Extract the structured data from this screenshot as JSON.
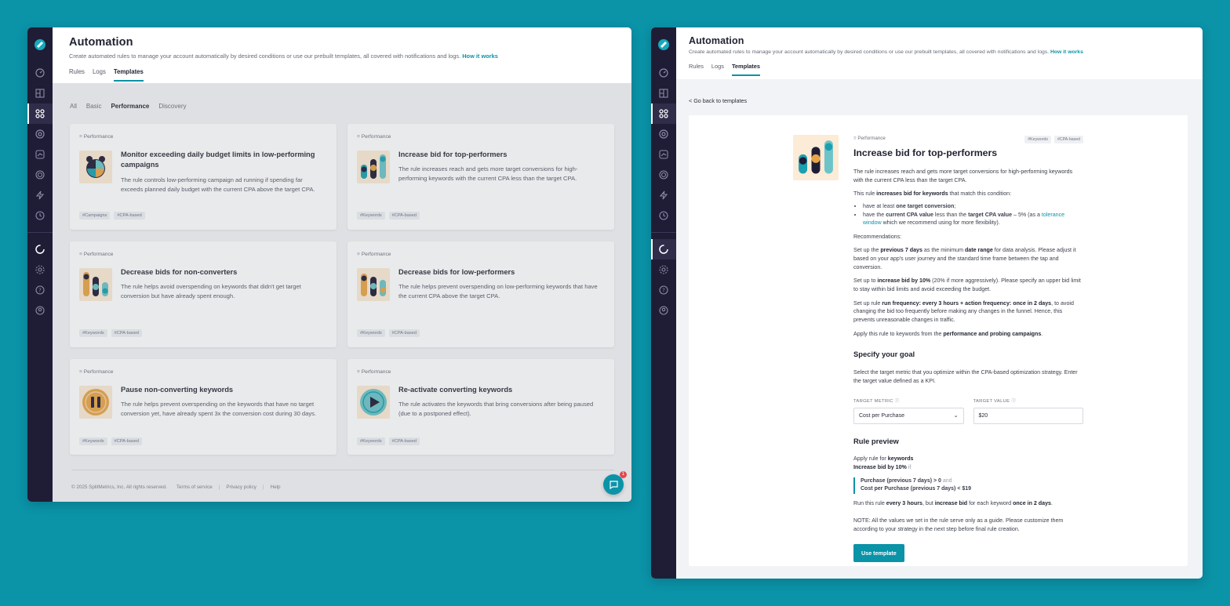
{
  "app": {
    "accent": "#0b93a8",
    "rail_color": "#1f1d36"
  },
  "header": {
    "title": "Automation",
    "description": "Create automated rules to manage your account automatically by desired conditions or use our prebuilt templates, all covered with notifications and logs.",
    "how_it_works": "How it works",
    "tabs": [
      {
        "label": "Rules"
      },
      {
        "label": "Logs"
      },
      {
        "label": "Templates"
      }
    ]
  },
  "filters": [
    "All",
    "Basic",
    "Performance",
    "Discovery"
  ],
  "cards": [
    {
      "tag": "Performance",
      "title": "Monitor exceeding daily budget limits in low-performing campaigns",
      "description": "The rule controls low-performing campaign ad running if spending far exceeds planned daily budget with the current CPA above the target CPA.",
      "chips": [
        "#Campaigns",
        "#CPA-based"
      ],
      "icon": "alarm-clock-icon"
    },
    {
      "tag": "Performance",
      "title": "Increase bid for top-performers",
      "description": "The rule increases reach and gets more target conversions for high-performing keywords with the current CPA less than the target CPA.",
      "chips": [
        "#Keywords",
        "#CPA-based"
      ],
      "icon": "bars-up-icon"
    },
    {
      "tag": "Performance",
      "title": "Decrease bids for non-converters",
      "description": "The rule helps avoid overspending on keywords that didn't get target conversion but have already spent enough.",
      "chips": [
        "#Keywords",
        "#CPA-based"
      ],
      "icon": "bars-down-icon"
    },
    {
      "tag": "Performance",
      "title": "Decrease bids for low-performers",
      "description": "The rule helps prevent overspending on low-performing keywords that have the current CPA above the target CPA.",
      "chips": [
        "#Keywords",
        "#CPA-based"
      ],
      "icon": "bars-mixed-icon"
    },
    {
      "tag": "Performance",
      "title": "Pause non-converting keywords",
      "description": "The rule helps prevent overspending on the keywords that have no target conversion yet, have already spent 3x the conversion cost during 30 days.",
      "chips": [
        "#Keywords",
        "#CPA-based"
      ],
      "icon": "pause-icon"
    },
    {
      "tag": "Performance",
      "title": "Re-activate converting keywords",
      "description": "The rule activates the keywords that bring conversions after being paused (due to a postponed effect).",
      "chips": [
        "#Keywords",
        "#CPA-based"
      ],
      "icon": "play-icon"
    }
  ],
  "footer": {
    "copyright": "© 2025 SplitMetrics, Inc. All rights reserved.",
    "terms": "Terms of service",
    "privacy": "Privacy policy",
    "help": "Help",
    "sep": "|",
    "chat_badge": "1"
  },
  "detail": {
    "back": "< Go back to templates",
    "tag": "Performance",
    "chips": [
      "#Keywords",
      "#CPA-based"
    ],
    "title": "Increase bid for top-performers",
    "intro": "The rule increases reach and gets more target conversions for high-performing keywords with the current CPA less than the target CPA.",
    "cond_a": "This rule ",
    "cond_b": "increases bid for keywords",
    "cond_c": " that match this condition:",
    "li1_a": "have at least ",
    "li1_b": "one target conversion",
    "li1_c": ";",
    "li2_a": "have the ",
    "li2_b": "current CPA value",
    "li2_c": " less than the ",
    "li2_d": "target CPA value",
    "li2_e": " – 5% (as a ",
    "li2_link": "tolerance window",
    "li2_f": " which we recommend using for more flexibility).",
    "rec_title": "Recommendations:",
    "r1_a": "Set up the ",
    "r1_b": "previous 7 days",
    "r1_c": " as the minimum ",
    "r1_d": "date range",
    "r1_e": " for data analysis. Please adjust it based on your app's user journey and the standard time frame between the tap and conversion.",
    "r2_a": "Set up to ",
    "r2_b": "increase bid by 10%",
    "r2_c": " (20% if more aggressively). Please specify an upper bid limit to stay within bid limits and avoid exceeding the budget.",
    "r3_a": "Set up rule ",
    "r3_b": "run frequency: every 3 hours + action frequency: once in 2 days",
    "r3_c": ", to avoid changing the bid too frequently before making any changes in the funnel. Hence, this prevents unreasonable changes in traffic.",
    "r4_a": "Apply this rule to keywords from the ",
    "r4_b": "performance and probing campaigns",
    "r4_c": ".",
    "goal_title": "Specify your goal",
    "goal_desc": "Select the target metric that you optimize within the CPA-based optimization strategy. Enter the target value defined as a KPI.",
    "metric_label": "TARGET METRIC",
    "metric_value": "Cost per Purchase",
    "value_label": "TARGET VALUE",
    "value_value": "$20",
    "preview_title": "Rule preview",
    "pv1_a": "Apply rule for ",
    "pv1_b": "keywords",
    "pv2_a": "Increase bid by 10%",
    "pv2_b": " if",
    "pv3_a": "Purchase (previous 7 days) > 0",
    "pv3_b": " and",
    "pv4": "Cost per Purchase (previous 7 days) < $19",
    "run_a": "Run this rule ",
    "run_b": "every 3 hours",
    "run_c": ", but ",
    "run_d": "increase bid",
    "run_e": " for each keyword ",
    "run_f": "once in 2 days",
    "run_g": ".",
    "note": "NOTE: All the values we set in the rule serve only as a guide. Please customize them according to your strategy in the next step before final rule creation.",
    "button": "Use template"
  }
}
